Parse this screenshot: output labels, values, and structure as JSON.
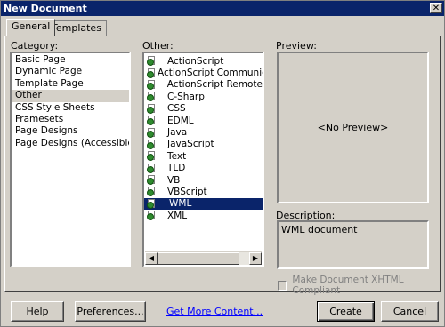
{
  "window": {
    "title": "New Document",
    "close_glyph": "✕"
  },
  "tabs": [
    {
      "label": "General",
      "active": true
    },
    {
      "label": "Templates",
      "active": false
    }
  ],
  "category": {
    "label": "Category:",
    "items": [
      {
        "label": "Basic Page"
      },
      {
        "label": "Dynamic Page"
      },
      {
        "label": "Template Page"
      },
      {
        "label": "Other",
        "selected": true
      },
      {
        "label": "CSS Style Sheets"
      },
      {
        "label": "Framesets"
      },
      {
        "label": "Page Designs"
      },
      {
        "label": "Page Designs (Accessible)"
      }
    ]
  },
  "other": {
    "label": "Other:",
    "items": [
      {
        "label": "ActionScript"
      },
      {
        "label": "ActionScript Communication"
      },
      {
        "label": "ActionScript Remote"
      },
      {
        "label": "C-Sharp"
      },
      {
        "label": "CSS"
      },
      {
        "label": "EDML"
      },
      {
        "label": "Java"
      },
      {
        "label": "JavaScript"
      },
      {
        "label": "Text"
      },
      {
        "label": "TLD"
      },
      {
        "label": "VB"
      },
      {
        "label": "VBScript"
      },
      {
        "label": "WML",
        "selected": true
      },
      {
        "label": "XML"
      }
    ],
    "scroll_left_glyph": "◀",
    "scroll_right_glyph": "▶"
  },
  "preview": {
    "label": "Preview:",
    "placeholder": "<No Preview>"
  },
  "description": {
    "label": "Description:",
    "text": "WML document"
  },
  "xhtml_checkbox": {
    "label": "Make Document XHTML Compliant",
    "checked": false,
    "disabled": true
  },
  "buttons": {
    "help": "Help",
    "preferences": "Preferences...",
    "get_more": "Get More Content...",
    "create": "Create",
    "cancel": "Cancel"
  },
  "colors": {
    "title_bar": "#0a246a",
    "selection": "#0a246a",
    "face": "#d4d0c8",
    "link": "#0000ff"
  },
  "icons": {
    "file_type": "document-icon"
  }
}
